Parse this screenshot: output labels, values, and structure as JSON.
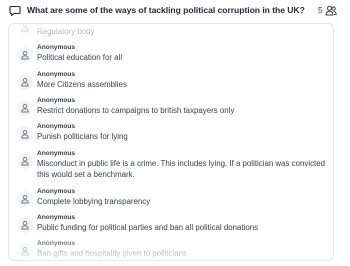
{
  "question": {
    "title": "What are some of the ways of tackling political corruption in the UK?",
    "participant_count": "5",
    "icon": "speech-bubble-icon",
    "count_icon": "people-icon"
  },
  "responses": [
    {
      "author": "Anonymous",
      "text": "Regulatory body"
    },
    {
      "author": "Anonymous",
      "text": "Political education for all"
    },
    {
      "author": "Anonymous",
      "text": "More Citizens assemblies"
    },
    {
      "author": "Anonymous",
      "text": "Restrict donations to campaigns to british taxpayers only"
    },
    {
      "author": "Anonymous",
      "text": "Punish politicians for lying"
    },
    {
      "author": "Anonymous",
      "text": "Misconduct in public life is a crime. This includes lying. If a politician was convicted this would set a benchmark."
    },
    {
      "author": "Anonymous",
      "text": "Complete lobbying transparency"
    },
    {
      "author": "Anonymous",
      "text": "Public funding for political parties and ban all political donations"
    },
    {
      "author": "Anonymous",
      "text": "Ban gifts and hospitality given to politicians"
    }
  ]
}
